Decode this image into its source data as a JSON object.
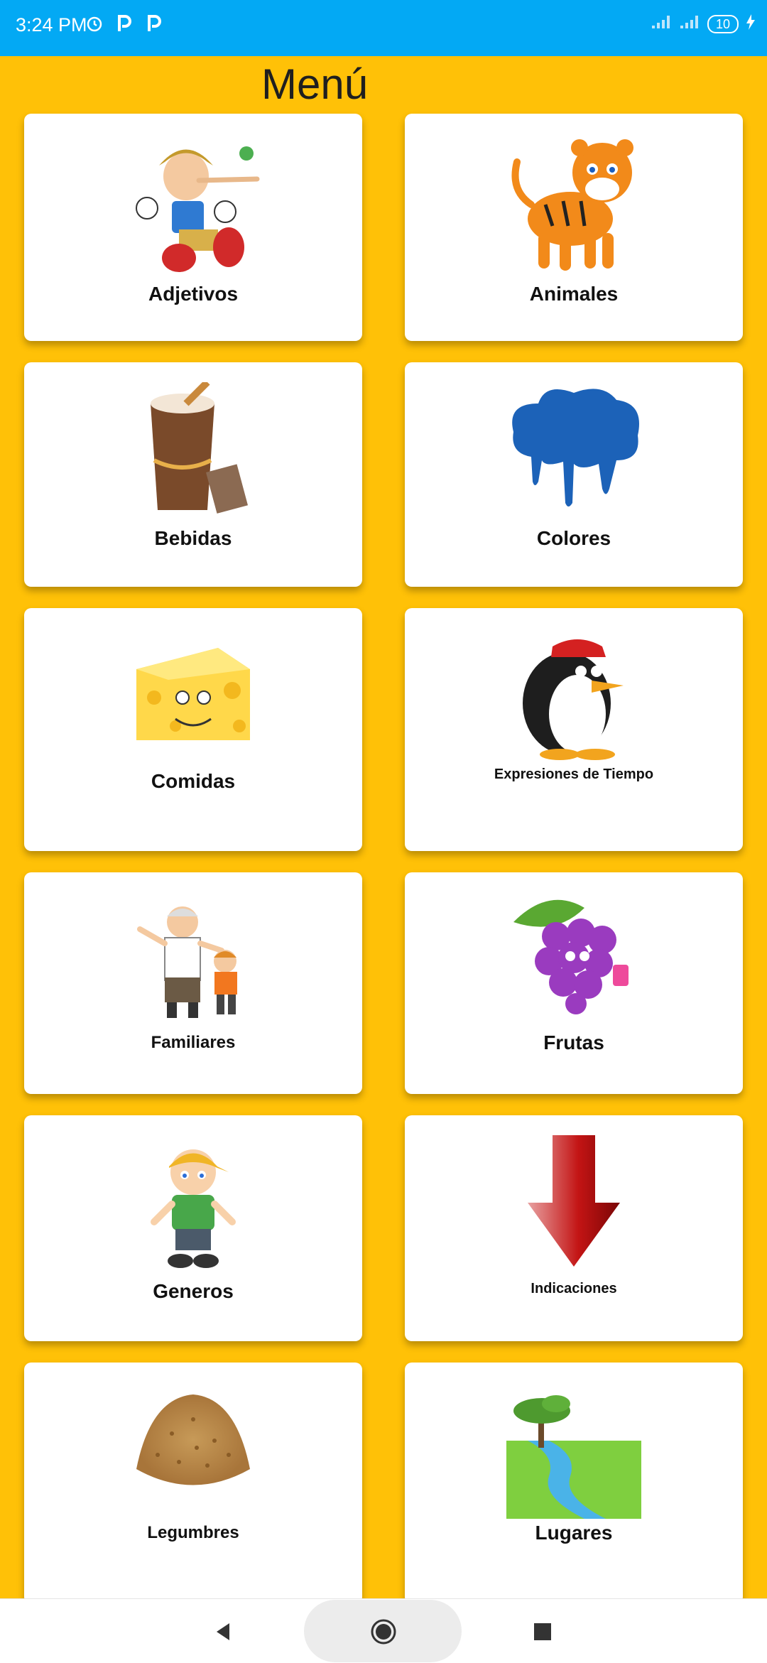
{
  "status_bar": {
    "time": "3:24 PM",
    "battery": "10",
    "icons": [
      "alarm-icon",
      "p-app-icon",
      "p-app-icon",
      "signal-icon",
      "signal-icon",
      "charging-icon"
    ]
  },
  "header": {
    "title": "Menú"
  },
  "menu": {
    "items": [
      {
        "label": "Adjetivos",
        "icon": "pinocchio-icon"
      },
      {
        "label": "Animales",
        "icon": "tiger-icon"
      },
      {
        "label": "Bebidas",
        "icon": "hot-chocolate-icon"
      },
      {
        "label": "Colores",
        "icon": "paint-splash-icon"
      },
      {
        "label": "Comidas",
        "icon": "cheese-icon"
      },
      {
        "label": "Expresiones de Tiempo",
        "icon": "penguin-icon"
      },
      {
        "label": "Familiares",
        "icon": "grandpa-kid-icon"
      },
      {
        "label": "Frutas",
        "icon": "grapes-icon"
      },
      {
        "label": "Generos",
        "icon": "boy-icon"
      },
      {
        "label": "Indicaciones",
        "icon": "down-arrow-icon"
      },
      {
        "label": "Legumbres",
        "icon": "grains-icon"
      },
      {
        "label": "Lugares",
        "icon": "landscape-icon"
      }
    ]
  },
  "navigation": {
    "back": "back-icon",
    "home": "home-icon",
    "recents": "recents-icon"
  },
  "colors": {
    "background": "#FFC107",
    "status_bar": "#03A9F4",
    "card": "#FFFFFF"
  }
}
